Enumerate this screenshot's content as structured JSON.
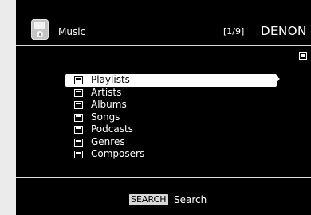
{
  "header": {
    "source_icon": "ipod-icon",
    "source_label": "Music",
    "page_indicator": "[1/9]",
    "brand": "DENON"
  },
  "indicator_icon": "checkbox-indicator-icon",
  "menu": {
    "items": [
      {
        "label": "Playlists",
        "icon": "folder-icon",
        "selected": true
      },
      {
        "label": "Artists",
        "icon": "folder-icon",
        "selected": false
      },
      {
        "label": "Albums",
        "icon": "folder-icon",
        "selected": false
      },
      {
        "label": "Songs",
        "icon": "folder-icon",
        "selected": false
      },
      {
        "label": "Podcasts",
        "icon": "folder-icon",
        "selected": false
      },
      {
        "label": "Genres",
        "icon": "folder-icon",
        "selected": false
      },
      {
        "label": "Composers",
        "icon": "folder-icon",
        "selected": false
      }
    ],
    "more_icon": "right-arrow-icon"
  },
  "footer": {
    "search_key": "SEARCH",
    "search_label": "Search"
  },
  "colors": {
    "background": "#000000",
    "text": "#ffffff",
    "highlight": "#ffffff",
    "frame": "#ebebeb"
  }
}
